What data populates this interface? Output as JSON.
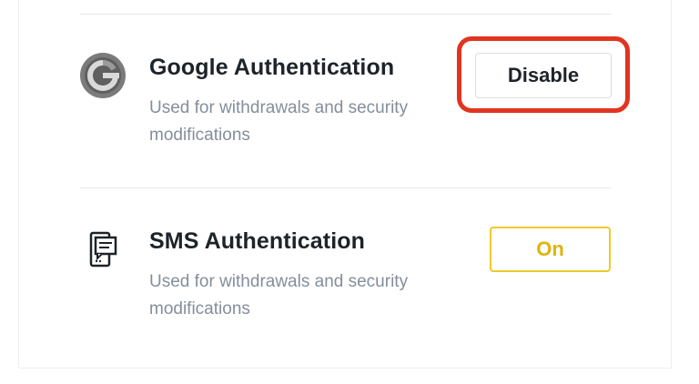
{
  "security": {
    "items": [
      {
        "icon": "google-authenticator-icon",
        "title": "Google Authentication",
        "description": "Used for withdrawals and security modifications",
        "action_label": "Disable"
      },
      {
        "icon": "sms-phone-icon",
        "title": "SMS Authentication",
        "description": "Used for withdrawals and security modifications",
        "action_label": "On"
      }
    ]
  },
  "colors": {
    "title_text": "#1e2329",
    "description_text": "#848e9c",
    "highlight_annotation": "#e1341e",
    "on_button_accent": "#f0c92c",
    "on_button_text": "#e0b40e"
  }
}
